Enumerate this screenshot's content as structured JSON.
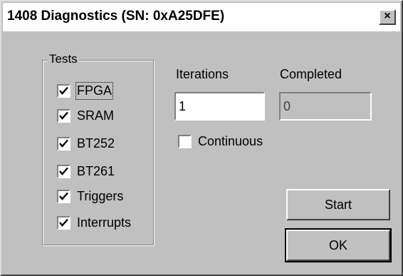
{
  "window": {
    "title": "1408 Diagnostics (SN: 0xA25DFE)",
    "close_glyph": "×"
  },
  "tests_group": {
    "label": "Tests",
    "items": [
      {
        "label": "FPGA",
        "checked": true
      },
      {
        "label": "SRAM",
        "checked": true
      },
      {
        "label": "BT252",
        "checked": true
      },
      {
        "label": "BT261",
        "checked": true
      },
      {
        "label": "Triggers",
        "checked": true
      },
      {
        "label": "Interrupts",
        "checked": true
      }
    ]
  },
  "iterations": {
    "label": "Iterations",
    "value": "1"
  },
  "completed": {
    "label": "Completed",
    "value": "0"
  },
  "continuous": {
    "label": "Continuous",
    "checked": false
  },
  "buttons": {
    "start_label": "Start",
    "ok_label": "OK"
  },
  "colors": {
    "dialog_bg": "#c0c0c0",
    "titlebar_bg": "#ffffff"
  }
}
